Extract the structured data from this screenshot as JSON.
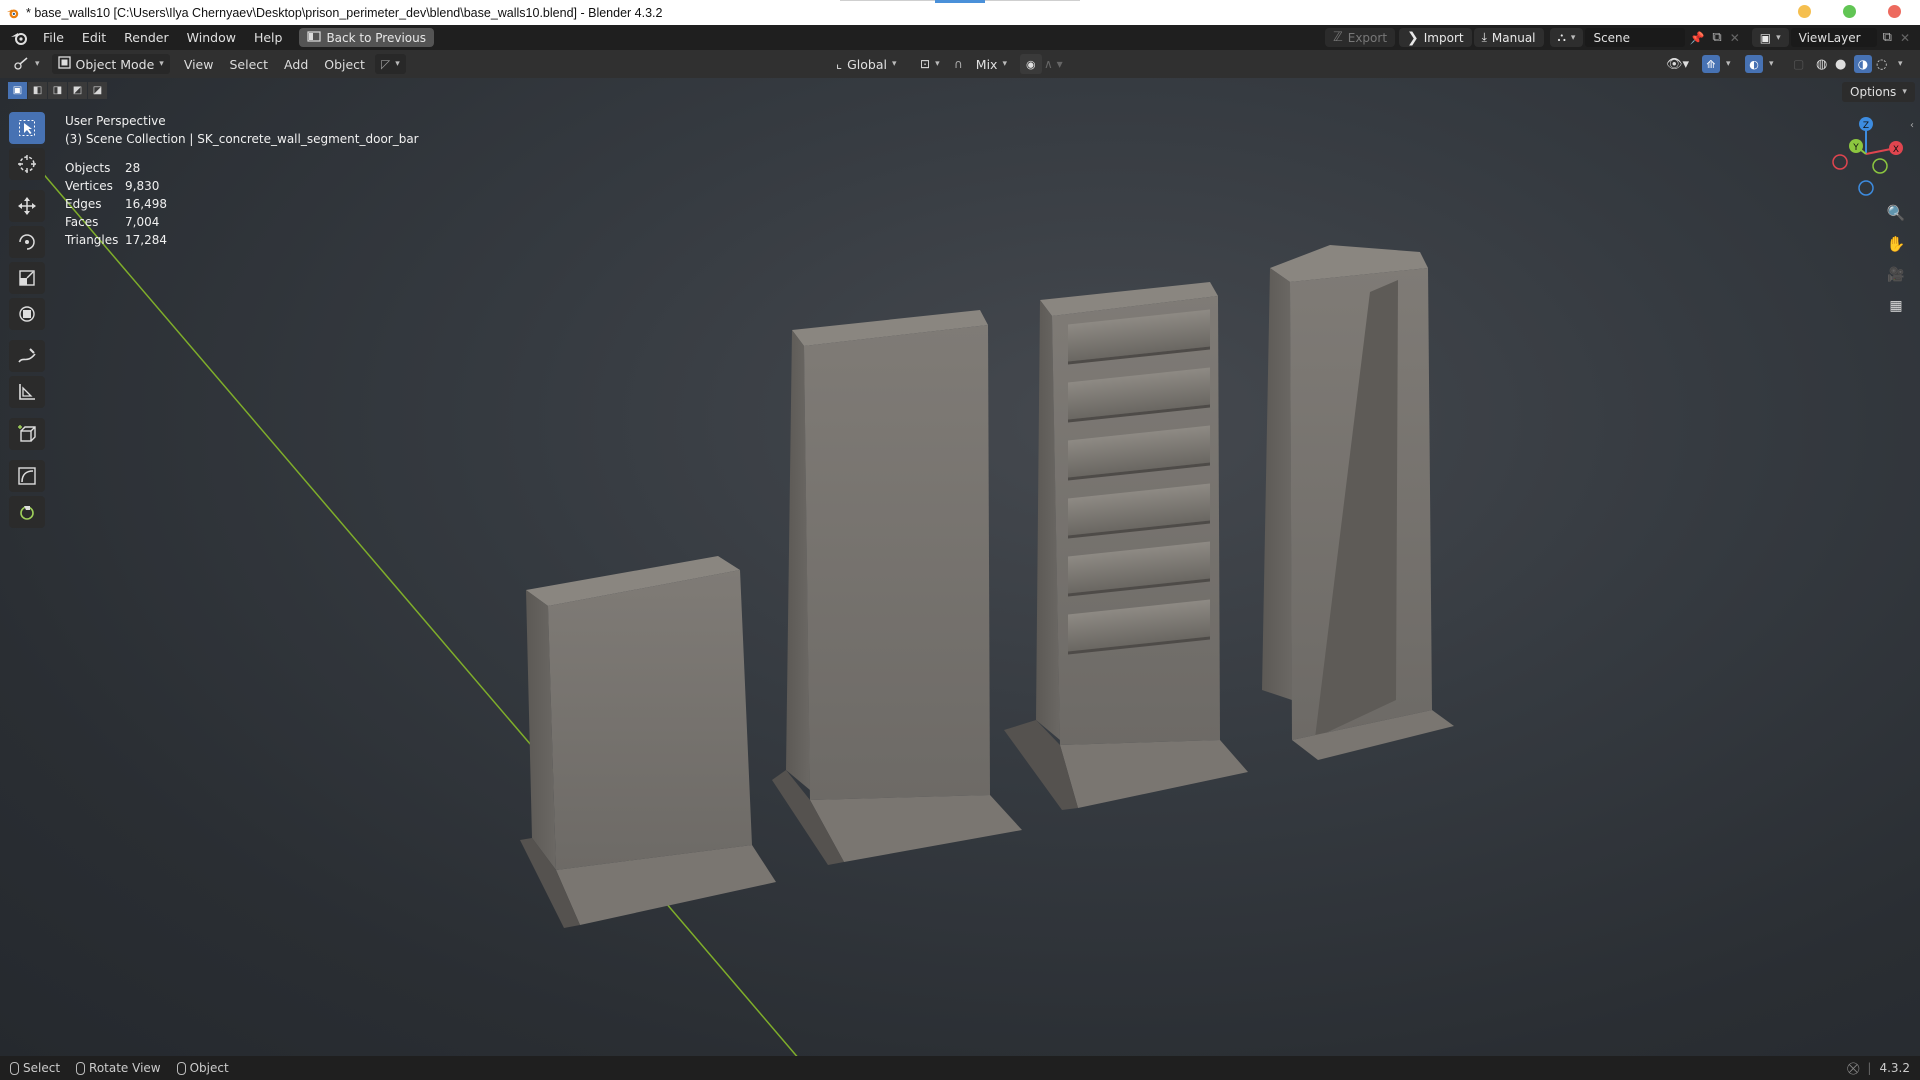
{
  "window": {
    "title": "* base_walls10 [C:\\Users\\Ilya Chernyaev\\Desktop\\prison_perimeter_dev\\blend\\base_walls10.blend] - Blender 4.3.2",
    "controls": {
      "minimize_color": "#f5bf4f",
      "maximize_color": "#61c554",
      "close_color": "#ed6a5e"
    }
  },
  "menubar": {
    "items": [
      "File",
      "Edit",
      "Render",
      "Window",
      "Help"
    ],
    "back_button": "Back to Previous",
    "export_label": "Export",
    "import_label": "Import",
    "manual_label": "Manual",
    "scene_value": "Scene",
    "view_layer_value": "ViewLayer"
  },
  "header": {
    "mode": "Object Mode",
    "menus": [
      "View",
      "Select",
      "Add",
      "Object"
    ],
    "transform_orientation": "Global",
    "snap_mode": "Mix",
    "options_label": "Options"
  },
  "viewport": {
    "view_name": "User Perspective",
    "collection_line": "(3) Scene Collection | SK_concrete_wall_segment_door_bar",
    "stats": [
      {
        "label": "Objects",
        "value": "28"
      },
      {
        "label": "Vertices",
        "value": "9,830"
      },
      {
        "label": "Edges",
        "value": "16,498"
      },
      {
        "label": "Faces",
        "value": "7,004"
      },
      {
        "label": "Triangles",
        "value": "17,284"
      }
    ],
    "gizmo": {
      "x_label": "X",
      "y_label": "Y",
      "z_label": "Z",
      "x_color": "#e0454f",
      "y_color": "#8cc63f",
      "z_color": "#3d8ce0"
    }
  },
  "statusbar": {
    "select_label": "Select",
    "rotate_label": "Rotate View",
    "object_label": "Object",
    "version": "4.3.2"
  },
  "colors": {
    "accent": "#4772b3",
    "viewport_bg": "#353a40"
  }
}
